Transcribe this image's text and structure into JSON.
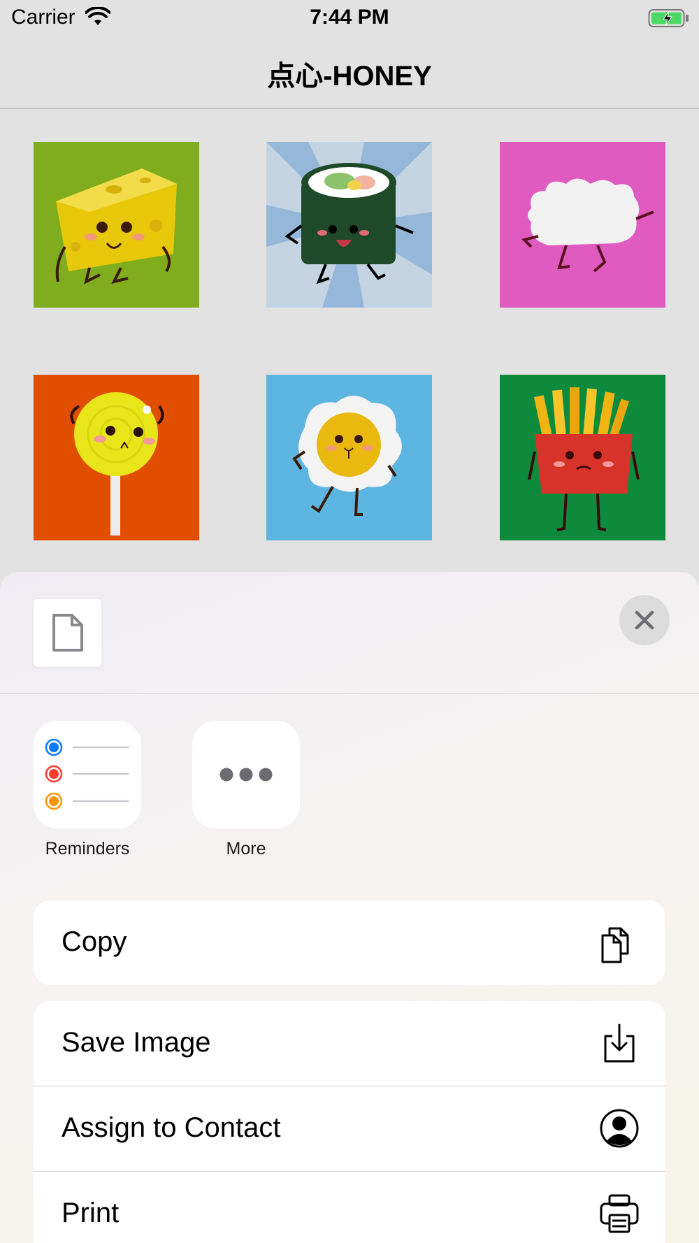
{
  "status_bar": {
    "carrier": "Carrier",
    "time": "7:44 PM"
  },
  "nav": {
    "title": "点心-HONEY"
  },
  "grid": [
    {
      "name": "cheese",
      "bg": "#7fad1e"
    },
    {
      "name": "sushi-roll",
      "bg": "#9dbedd"
    },
    {
      "name": "rice-cake",
      "bg": "#e05bbf"
    },
    {
      "name": "lollipop",
      "bg": "#e24e00"
    },
    {
      "name": "fried-egg",
      "bg": "#5db5e2"
    },
    {
      "name": "french-fries",
      "bg": "#0e8a3c"
    }
  ],
  "share_sheet": {
    "apps": [
      {
        "label": "Reminders",
        "icon": "reminders-icon"
      },
      {
        "label": "More",
        "icon": "more-icon"
      }
    ],
    "actions": [
      {
        "label": "Copy",
        "icon": "copy-icon"
      },
      {
        "label": "Save Image",
        "icon": "save-image-icon"
      },
      {
        "label": "Assign to Contact",
        "icon": "contact-icon"
      },
      {
        "label": "Print",
        "icon": "print-icon"
      }
    ]
  },
  "colors": {
    "reminder_blue": "#0a7aff",
    "reminder_red": "#ff3b30",
    "reminder_orange": "#ff9500",
    "battery_green": "#4cd964"
  }
}
